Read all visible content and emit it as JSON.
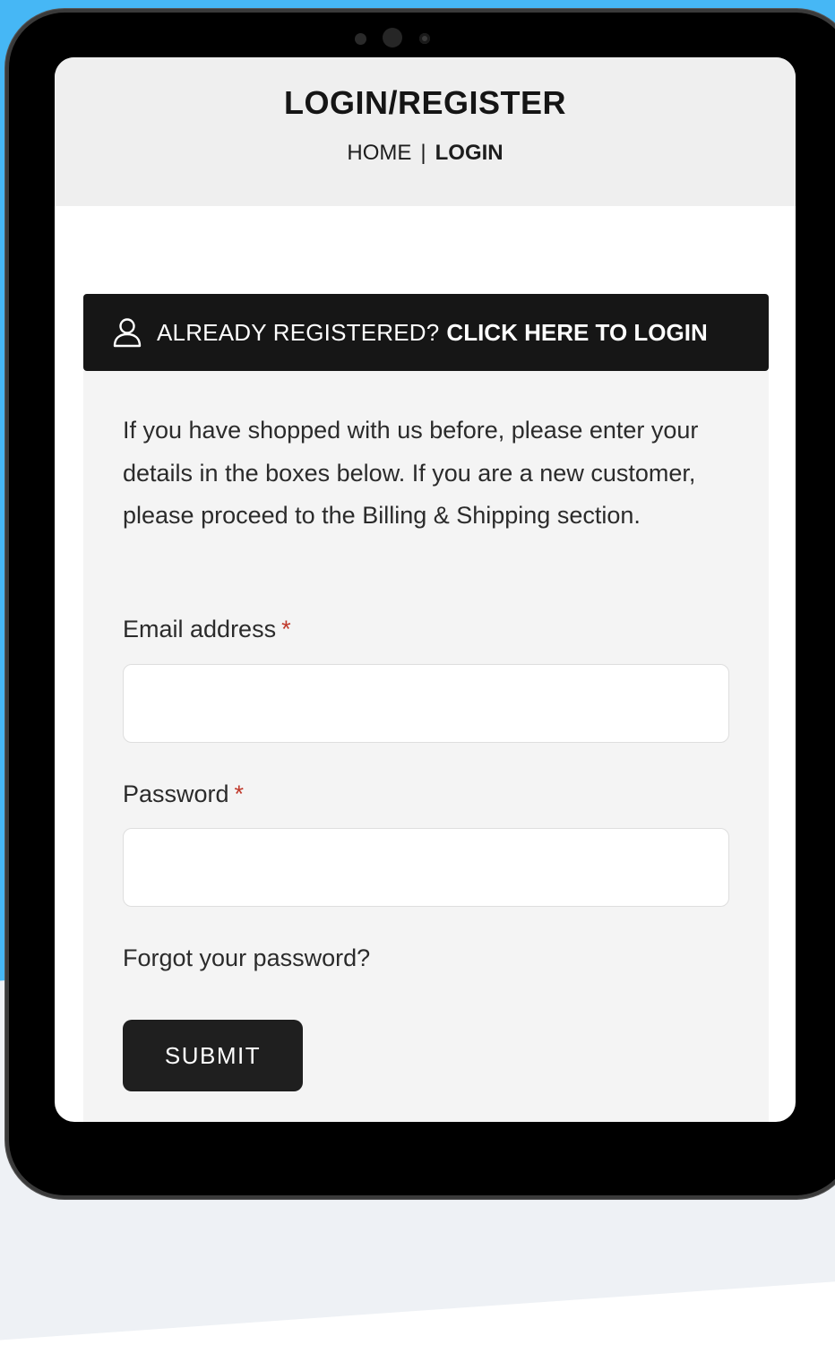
{
  "header": {
    "title": "LOGIN/REGISTER",
    "breadcrumb": {
      "home": "HOME",
      "separator": "|",
      "current": "LOGIN"
    }
  },
  "login_bar": {
    "icon": "user-icon",
    "prompt": "ALREADY REGISTERED?",
    "link": "CLICK HERE TO LOGIN"
  },
  "form": {
    "intro": "If you have shopped with us before, please enter your details in the boxes below. If you are a new customer, please proceed to the Billing & Shipping section.",
    "email": {
      "label": "Email address",
      "required_mark": "*",
      "value": ""
    },
    "password": {
      "label": "Password",
      "required_mark": "*",
      "value": ""
    },
    "forgot_link": "Forgot your password?",
    "submit_label": "SUBMIT"
  },
  "colors": {
    "background": "#46b7f5",
    "header_bg": "#efefef",
    "bar_bg": "#161616",
    "panel_bg": "#f4f4f4",
    "required": "#c0392b",
    "button_bg": "#1f1f1f"
  }
}
